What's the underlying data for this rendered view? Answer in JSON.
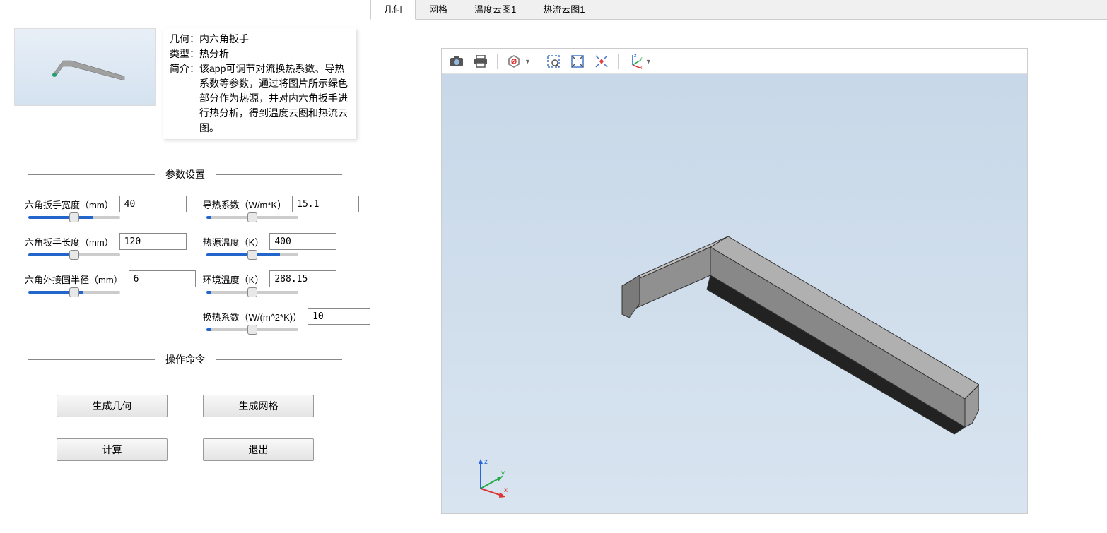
{
  "info": {
    "geometry_label": "几何：",
    "geometry_value": "内六角扳手",
    "type_label": "类型：",
    "type_value": "热分析",
    "summary_label": "简介：",
    "summary_value": "该app可调节对流换热系数、导热系数等参数，通过将图片所示绿色部分作为热源，并对内六角扳手进行热分析，得到温度云图和热流云图。"
  },
  "sections": {
    "params": "参数设置",
    "commands": "操作命令"
  },
  "params": [
    {
      "label": "六角扳手宽度（mm）",
      "value": "40",
      "pct": 70
    },
    {
      "label": "六角扳手长度（mm）",
      "value": "120",
      "pct": 55
    },
    {
      "label": "六角外接圆半径（mm）",
      "value": "6",
      "pct": 60
    },
    {
      "label": "导热系数（W/m*K）",
      "value": "15.1",
      "pct": 5
    },
    {
      "label": "热源温度（K）",
      "value": "400",
      "pct": 80
    },
    {
      "label": "环境温度（K）",
      "value": "288.15",
      "pct": 5
    },
    {
      "label": "换热系数（W/(m^2*K)）",
      "value": "10",
      "pct": 5
    }
  ],
  "commands": {
    "gen_geometry": "生成几何",
    "gen_mesh": "生成网格",
    "compute": "计算",
    "exit": "退出"
  },
  "tabs": [
    "几何",
    "网格",
    "温度云图1",
    "热流云图1"
  ],
  "active_tab": 0,
  "axes": {
    "x": "x",
    "y": "y",
    "z": "z"
  }
}
